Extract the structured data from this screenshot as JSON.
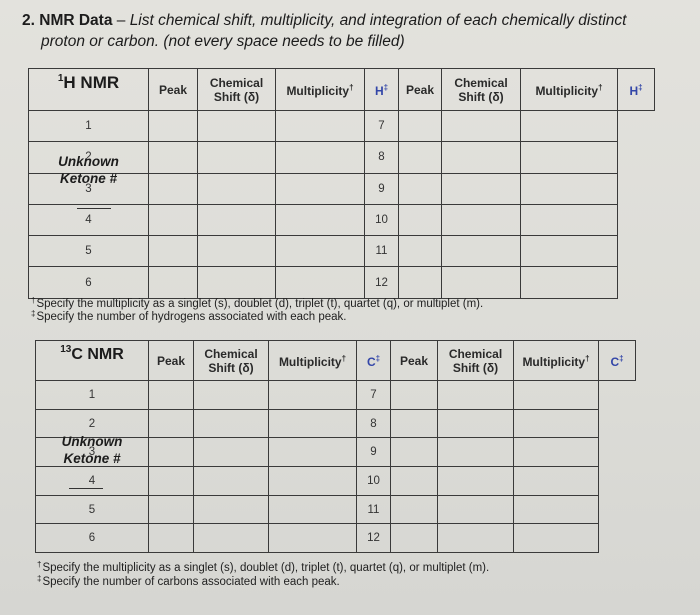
{
  "question": {
    "number": "2.",
    "title_bold": "NMR Data",
    "dash": " – ",
    "instruction_line1": "List chemical shift, multiplicity, and integration of each chemically distinct",
    "instruction_line2": "proton or carbon. (not every space needs to be filled)"
  },
  "h_nmr": {
    "title_sup": "1",
    "title": "H NMR",
    "unknown_line1": "Unknown",
    "unknown_line2": "Ketone #",
    "headers": {
      "peak": "Peak",
      "chem_shift_line1": "Chemical",
      "chem_shift_line2": "Shift (δ)",
      "multiplicity": "Multiplicity",
      "multiplicity_mark": "†",
      "count": "H",
      "count_mark": "‡"
    },
    "count_header_color": "#3346a8",
    "rows": [
      {
        "left_peak": "1",
        "left_shift": "",
        "left_mult": "",
        "left_count": "",
        "right_peak": "7",
        "right_shift": "",
        "right_mult": "",
        "right_count": ""
      },
      {
        "left_peak": "2",
        "left_shift": "",
        "left_mult": "",
        "left_count": "",
        "right_peak": "8",
        "right_shift": "",
        "right_mult": "",
        "right_count": ""
      },
      {
        "left_peak": "3",
        "left_shift": "",
        "left_mult": "",
        "left_count": "",
        "right_peak": "9",
        "right_shift": "",
        "right_mult": "",
        "right_count": ""
      },
      {
        "left_peak": "4",
        "left_shift": "",
        "left_mult": "",
        "left_count": "",
        "right_peak": "10",
        "right_shift": "",
        "right_mult": "",
        "right_count": ""
      },
      {
        "left_peak": "5",
        "left_shift": "",
        "left_mult": "",
        "left_count": "",
        "right_peak": "11",
        "right_shift": "",
        "right_mult": "",
        "right_count": ""
      },
      {
        "left_peak": "6",
        "left_shift": "",
        "left_mult": "",
        "left_count": "",
        "right_peak": "12",
        "right_shift": "",
        "right_mult": "",
        "right_count": ""
      }
    ],
    "footnotes": [
      {
        "mark": "†",
        "text": "Specify the multiplicity as a singlet (s), doublet (d), triplet (t), quartet (q), or multiplet (m)."
      },
      {
        "mark": "‡",
        "text": "Specify the number of hydrogens associated with each peak."
      }
    ]
  },
  "c_nmr": {
    "title_sup": "13",
    "title": "C NMR",
    "unknown_line1": "Unknown",
    "unknown_line2": "Ketone #",
    "headers": {
      "peak": "Peak",
      "chem_shift_line1": "Chemical",
      "chem_shift_line2": "Shift (δ)",
      "multiplicity": "Multiplicity",
      "multiplicity_mark": "†",
      "count": "C",
      "count_mark": "‡"
    },
    "count_header_color": "#3346a8",
    "rows": [
      {
        "left_peak": "1",
        "left_shift": "",
        "left_mult": "",
        "left_count": "",
        "right_peak": "7",
        "right_shift": "",
        "right_mult": "",
        "right_count": ""
      },
      {
        "left_peak": "2",
        "left_shift": "",
        "left_mult": "",
        "left_count": "",
        "right_peak": "8",
        "right_shift": "",
        "right_mult": "",
        "right_count": ""
      },
      {
        "left_peak": "3",
        "left_shift": "",
        "left_mult": "",
        "left_count": "",
        "right_peak": "9",
        "right_shift": "",
        "right_mult": "",
        "right_count": ""
      },
      {
        "left_peak": "4",
        "left_shift": "",
        "left_mult": "",
        "left_count": "",
        "right_peak": "10",
        "right_shift": "",
        "right_mult": "",
        "right_count": ""
      },
      {
        "left_peak": "5",
        "left_shift": "",
        "left_mult": "",
        "left_count": "",
        "right_peak": "11",
        "right_shift": "",
        "right_mult": "",
        "right_count": ""
      },
      {
        "left_peak": "6",
        "left_shift": "",
        "left_mult": "",
        "left_count": "",
        "right_peak": "12",
        "right_shift": "",
        "right_mult": "",
        "right_count": ""
      }
    ],
    "footnotes": [
      {
        "mark": "†",
        "text": "Specify the multiplicity as a singlet (s), doublet (d), triplet (t), quartet (q), or multiplet (m)."
      },
      {
        "mark": "‡",
        "text": "Specify the number of carbons associated with each peak."
      }
    ]
  }
}
